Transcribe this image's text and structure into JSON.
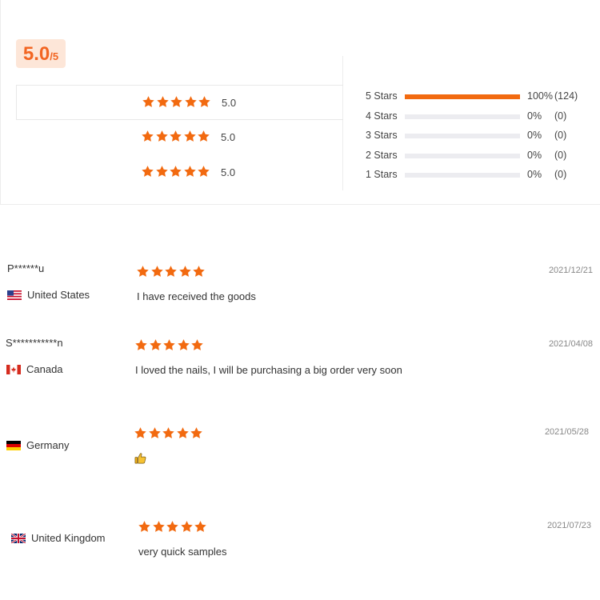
{
  "summary": {
    "score": "5.0",
    "out_of": "/5",
    "sub_ratings": [
      {
        "value": "5.0",
        "stars": 5
      },
      {
        "value": "5.0",
        "stars": 5
      },
      {
        "value": "5.0",
        "stars": 5
      }
    ],
    "distribution": [
      {
        "label": "5 Stars",
        "fraction": 1.0,
        "percent": "100%",
        "count": "(124)"
      },
      {
        "label": "4 Stars",
        "fraction": 0,
        "percent": "0%",
        "count": "(0)"
      },
      {
        "label": "3 Stars",
        "fraction": 0,
        "percent": "0%",
        "count": "(0)"
      },
      {
        "label": "2 Stars",
        "fraction": 0,
        "percent": "0%",
        "count": "(0)"
      },
      {
        "label": "1 Stars",
        "fraction": 0,
        "percent": "0%",
        "count": "(0)"
      }
    ]
  },
  "colors": {
    "accent": "#f26522",
    "star": "#f26a10",
    "badge_bg": "#fde6d8",
    "track": "#ececf0"
  },
  "reviews": [
    {
      "user": "P******u",
      "country": "United States",
      "flag": "us-flag-icon",
      "rating": 5,
      "date": "2021/12/21",
      "text": "I have received the goods"
    },
    {
      "user": "S***********n",
      "country": "Canada",
      "flag": "ca-flag-icon",
      "rating": 5,
      "date": "2021/04/08",
      "text": "I loved the nails, I will be purchasing a big order very soon"
    },
    {
      "user": "",
      "country": "Germany",
      "flag": "de-flag-icon",
      "rating": 5,
      "date": "2021/05/28",
      "text": "",
      "icon": "thumbs-up-icon"
    },
    {
      "user": "",
      "country": "United Kingdom",
      "flag": "gb-flag-icon",
      "rating": 5,
      "date": "2021/07/23",
      "text": "very quick samples"
    }
  ]
}
